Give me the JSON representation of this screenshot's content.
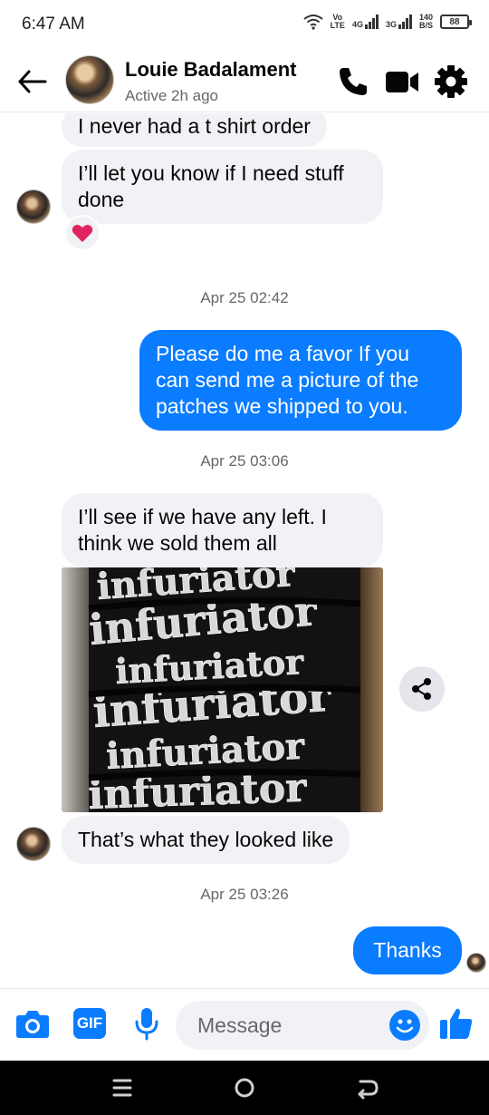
{
  "status_bar": {
    "time": "6:47 AM",
    "vo_lte_top": "Vo",
    "vo_lte_bottom": "LTE",
    "net1": "4G",
    "net2": "3G",
    "speed_top": "140",
    "speed_bottom": "B/S",
    "battery": "88"
  },
  "header": {
    "contact_name": "Louie Badalament",
    "contact_status": "Active 2h ago"
  },
  "messages": {
    "m1": "I never had a t shirt order",
    "m2": "I’ll let you know if I need stuff done",
    "time1": "Apr 25 02:42",
    "m3": "Please do me a favor If you can send me a picture of the patches we shipped to you.",
    "time2": "Apr 25 03:06",
    "m4": "I’ll see if we have any left. I think we sold them all",
    "photo_text": "infuriator",
    "m5": "That’s what they looked like",
    "time3": "Apr 25 03:26",
    "m6": "Thanks"
  },
  "composer": {
    "placeholder": "Message",
    "gif_label": "GIF"
  },
  "icons": {
    "back": "back-arrow-icon",
    "call": "phone-icon",
    "video": "video-camera-icon",
    "settings": "gear-icon",
    "camera": "camera-icon",
    "gif": "gif-icon",
    "mic": "microphone-icon",
    "emoji": "emoji-icon",
    "like": "thumbs-up-icon",
    "share": "share-icon",
    "reaction": "heart-icon"
  },
  "colors": {
    "accent": "#0a7cff",
    "incoming_bubble": "#f0f2f5",
    "reaction_heart": "#e0245e"
  }
}
